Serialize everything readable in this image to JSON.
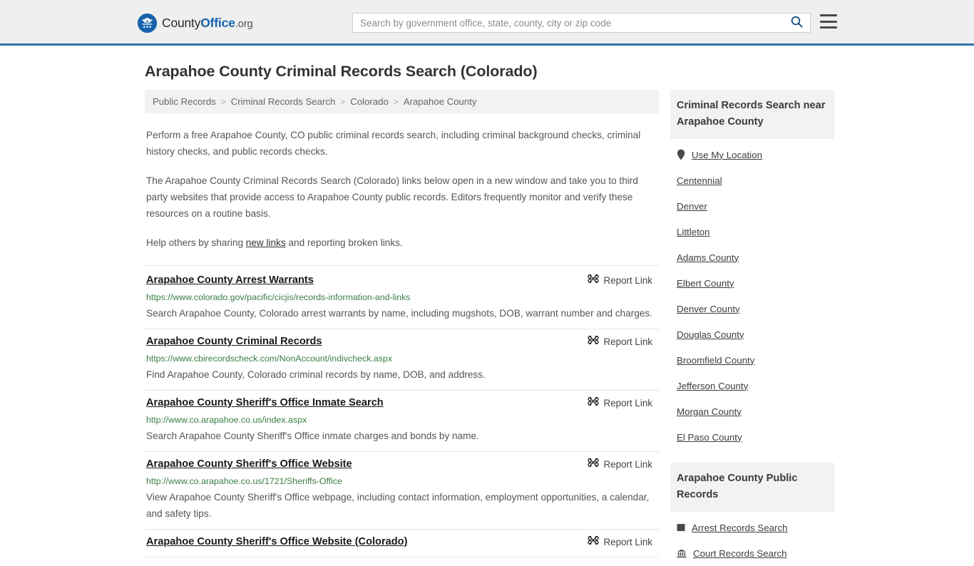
{
  "header": {
    "logo": {
      "icon": "eagle-seal-icon",
      "text_plain": "County",
      "text_bold": "Office",
      "text_suffix": ".org"
    },
    "search": {
      "placeholder": "Search by government office, state, county, city or zip code",
      "value": "",
      "icon": "search-icon"
    },
    "menu_icon": "hamburger-menu-icon"
  },
  "page": {
    "title": "Arapahoe County Criminal Records Search (Colorado)"
  },
  "breadcrumb": {
    "items": [
      {
        "label": "Public Records"
      },
      {
        "label": "Criminal Records Search"
      },
      {
        "label": "Colorado"
      },
      {
        "label": "Arapahoe County"
      }
    ],
    "separator": ">"
  },
  "intro": {
    "p1": "Perform a free Arapahoe County, CO public criminal records search, including criminal background checks, criminal history checks, and public records checks.",
    "p2": "The Arapahoe County Criminal Records Search (Colorado) links below open in a new window and take you to third party websites that provide access to Arapahoe County public records. Editors frequently monitor and verify these resources on a routine basis.",
    "p3_before": "Help others by sharing ",
    "p3_link": "new links",
    "p3_after": " and reporting broken links."
  },
  "report_link": {
    "label": "Report Link",
    "icon": "broken-link-icon"
  },
  "links": [
    {
      "title": "Arapahoe County Arrest Warrants",
      "url": "https://www.colorado.gov/pacific/cicjis/records-information-and-links",
      "description": "Search Arapahoe County, Colorado arrest warrants by name, including mugshots, DOB, warrant number and charges."
    },
    {
      "title": "Arapahoe County Criminal Records",
      "url": "https://www.cbirecordscheck.com/NonAccount/indivcheck.aspx",
      "description": "Find Arapahoe County, Colorado criminal records by name, DOB, and address."
    },
    {
      "title": "Arapahoe County Sheriff's Office Inmate Search",
      "url": "http://www.co.arapahoe.co.us/index.aspx",
      "description": "Search Arapahoe County Sheriff's Office inmate charges and bonds by name."
    },
    {
      "title": "Arapahoe County Sheriff's Office Website",
      "url": "http://www.co.arapahoe.co.us/1721/Sheriffs-Office",
      "description": "View Arapahoe County Sheriff's Office webpage, including contact information, employment opportunities, a calendar, and safety tips."
    },
    {
      "title": "Arapahoe County Sheriff's Office Website (Colorado)",
      "url": "",
      "description": ""
    }
  ],
  "sidebar": {
    "nearby": {
      "title": "Criminal Records Search near Arapahoe County",
      "items": [
        {
          "label": "Use My Location",
          "icon": "map-pin-icon"
        },
        {
          "label": "Centennial",
          "icon": ""
        },
        {
          "label": "Denver",
          "icon": ""
        },
        {
          "label": "Littleton",
          "icon": ""
        },
        {
          "label": "Adams County",
          "icon": ""
        },
        {
          "label": "Elbert County",
          "icon": ""
        },
        {
          "label": "Denver County",
          "icon": ""
        },
        {
          "label": "Douglas County",
          "icon": ""
        },
        {
          "label": "Broomfield County",
          "icon": ""
        },
        {
          "label": "Jefferson County",
          "icon": ""
        },
        {
          "label": "Morgan County",
          "icon": ""
        },
        {
          "label": "El Paso County",
          "icon": ""
        }
      ]
    },
    "public_records": {
      "title": "Arapahoe County Public Records",
      "items": [
        {
          "label": "Arrest Records Search",
          "icon": "square-icon"
        },
        {
          "label": "Court Records Search",
          "icon": "courthouse-icon"
        }
      ]
    }
  },
  "colors": {
    "header_bg": "#efefef",
    "header_border": "#3071a9",
    "brand_blue": "#1763ad",
    "url_green": "#3a7d44",
    "panel_gray": "#f2f2f2",
    "text": "#333333"
  }
}
